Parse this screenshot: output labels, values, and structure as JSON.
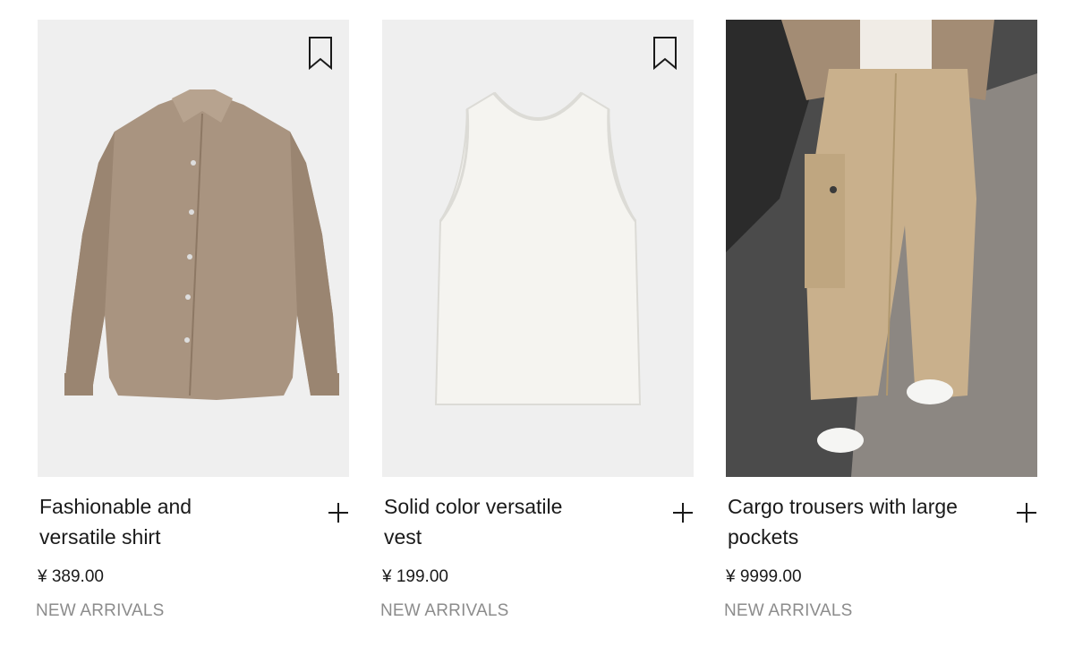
{
  "products": [
    {
      "name": "Fashionable and versatile shirt",
      "price": "¥ 389.00",
      "tag": "NEW ARRIVALS",
      "image_icon": "shirt-image",
      "color": "#a99480"
    },
    {
      "name": "Solid color versatile vest",
      "price": "¥ 199.00",
      "tag": "NEW ARRIVALS",
      "image_icon": "vest-image",
      "color": "#f3f2ee"
    },
    {
      "name": "Cargo trousers with large pockets",
      "price": "¥ 9999.00",
      "tag": "NEW ARRIVALS",
      "image_icon": "trousers-image",
      "color": "#c9b08c"
    }
  ],
  "icons": {
    "bookmark": "bookmark-icon",
    "add": "plus-icon"
  }
}
